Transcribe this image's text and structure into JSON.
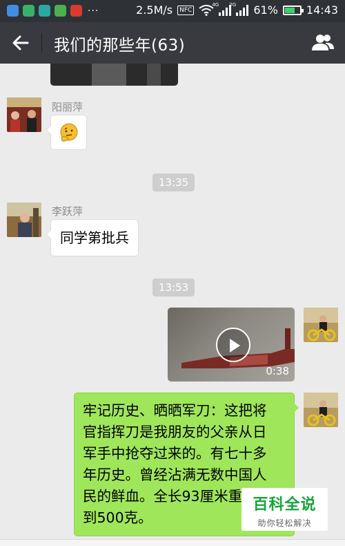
{
  "status_bar": {
    "speed": "2.5M/s",
    "nfc": "NFC",
    "net_4g": "4G",
    "net_2g": "2G",
    "battery": "61%",
    "battery_level": 0.61,
    "time": "14:43",
    "dots": "···"
  },
  "titlebar": {
    "title": "我们的那些年(63)",
    "back_icon": "back-arrow-icon",
    "members_icon": "group-people-icon"
  },
  "messages": {
    "m1": {
      "sender": "阳丽萍",
      "content_icon": "thinking-face-emoji"
    },
    "time1": "13:35",
    "m2": {
      "sender": "李跃萍",
      "text": "同学第批兵"
    },
    "time2": "13:53",
    "m3": {
      "type": "video",
      "duration": "0:38"
    },
    "m4": {
      "text": "牢记历史、晒晒军刀：这把将\n官指挥刀是我朋友的父亲从日\n军手中抢夺过来的。有七十多\n年历史。曾经沾满无数中国人\n民的鲜血。全长93厘米重量近\n到500克。"
    }
  },
  "watermark": {
    "title": "百科全说",
    "subtitle": "助你轻松解决"
  }
}
